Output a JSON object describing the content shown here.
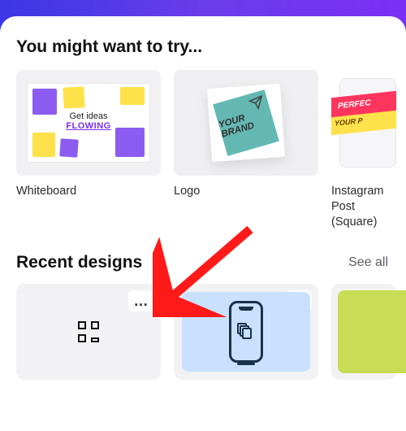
{
  "try_section": {
    "title": "You might want to try...",
    "items": [
      {
        "label": "Whiteboard",
        "art": {
          "line1": "Get ideas",
          "line2": "FLOWING"
        }
      },
      {
        "label": "Logo",
        "art": {
          "text": "YOUR BRAND"
        }
      },
      {
        "label": "Instagram Post (Square)",
        "art": {
          "band1": "PERFEC",
          "band2": "YOUR P"
        }
      }
    ]
  },
  "recent_section": {
    "title": "Recent designs",
    "see_all": "See all",
    "more_glyph": "…",
    "items": [
      {
        "kind": "grid"
      },
      {
        "kind": "phone"
      },
      {
        "kind": "green",
        "close_glyph": "✕"
      }
    ]
  },
  "annotation": {
    "arrow_color": "#ff1a1a"
  }
}
